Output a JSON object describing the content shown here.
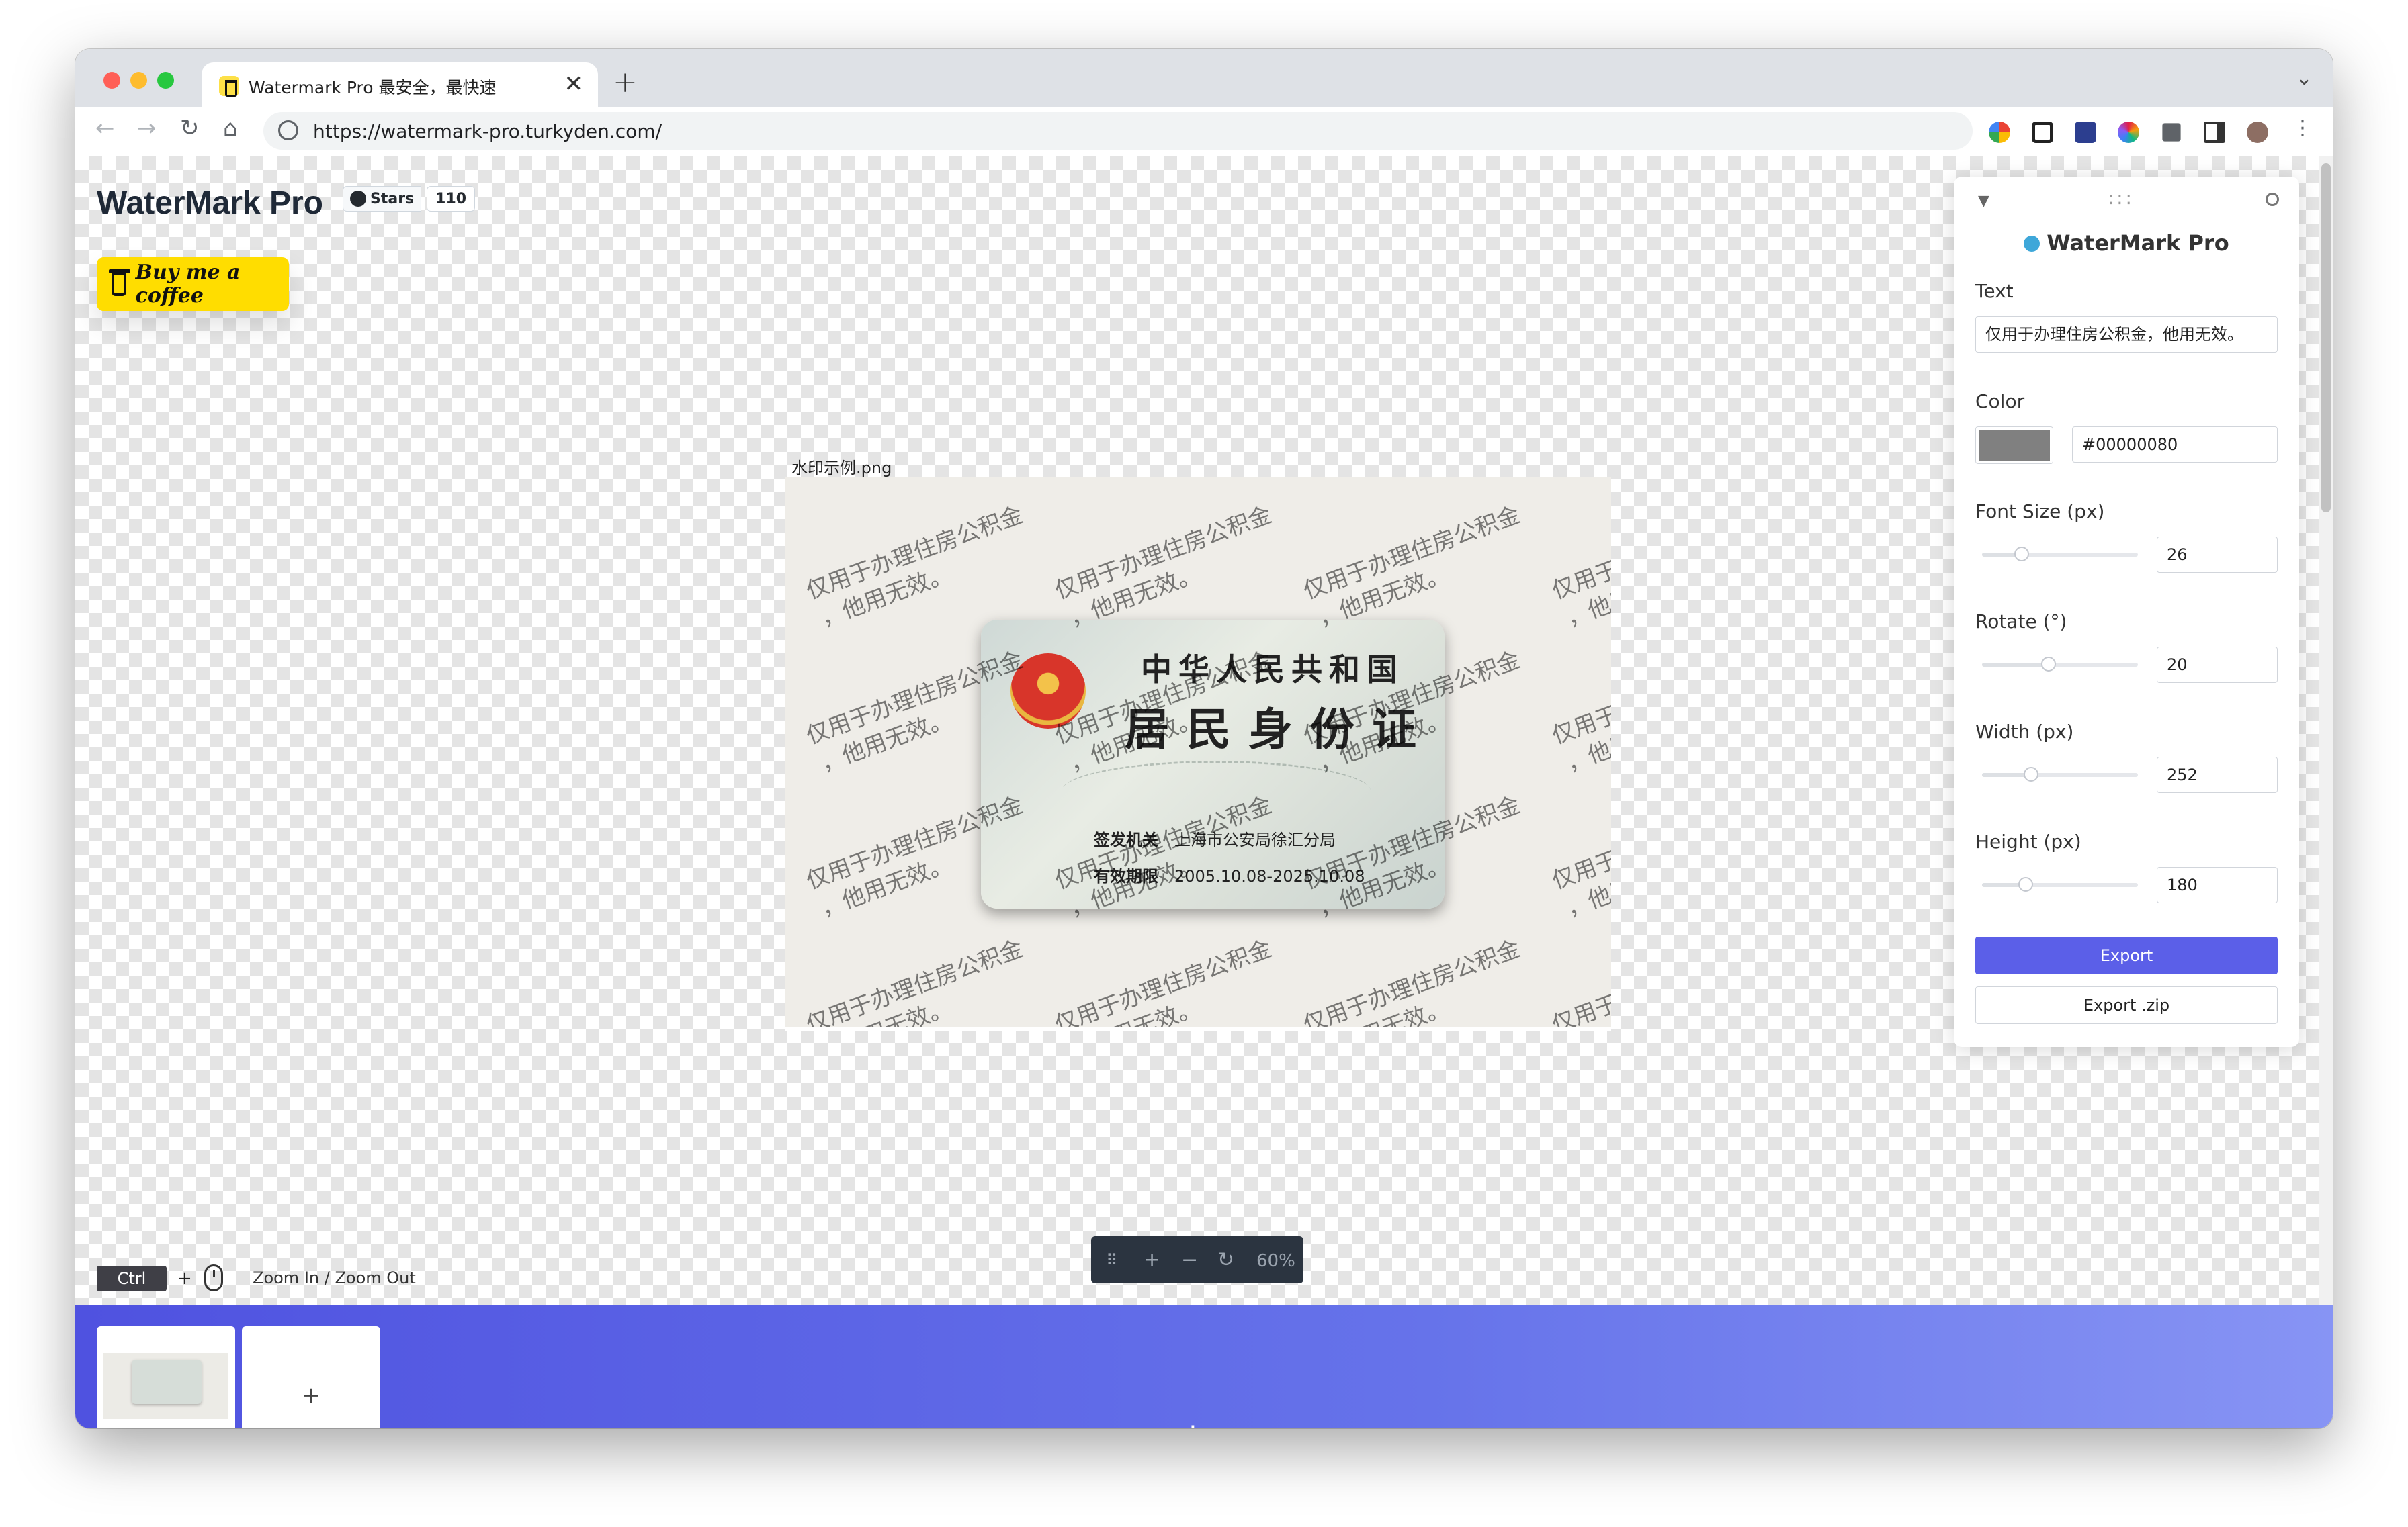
{
  "browser": {
    "tab_title": "Watermark Pro 最安全，最快速",
    "url": "https://watermark-pro.turkyden.com/",
    "new_tab_label": "+",
    "close_tab_label": "✕"
  },
  "header": {
    "brand": "WaterMark Pro",
    "github_label": "Stars",
    "github_count": "110",
    "coffee_label": "Buy me a coffee"
  },
  "preview": {
    "file_name": "水印示例.png",
    "card_title_line1": "中华人民共和国",
    "card_title_line2": "居民身份证",
    "issuer_label": "签发机关",
    "issuer_value": "上海市公安局徐汇分局",
    "valid_label": "有效期限",
    "valid_value": "2005.10.08-2025.10.08",
    "watermark_line1": "仅用于办理住房公积金",
    "watermark_line2": "，他用无效。",
    "watermark_line2_short": "，他用",
    "watermark_line1_short": "仅用于"
  },
  "zoom_hint": {
    "key": "Ctrl",
    "plus": "+",
    "text": "Zoom In / Zoom Out"
  },
  "zoom_bar": {
    "percent": "60%"
  },
  "panel": {
    "title": "WaterMark Pro",
    "text_label": "Text",
    "text_value": "仅用于办理住房公积金，他用无效。",
    "color_label": "Color",
    "color_value": "#00000080",
    "swatch_color": "#808080",
    "font_size_label": "Font Size (px)",
    "font_size_value": "26",
    "rotate_label": "Rotate (°)",
    "rotate_value": "20",
    "width_label": "Width (px)",
    "width_value": "252",
    "height_label": "Height (px)",
    "height_value": "180",
    "export_label": "Export",
    "export_zip_label": "Export .zip"
  },
  "gallery": {
    "add_label": "+"
  },
  "colors": {
    "accent": "#5b5fe8",
    "coffee": "#ffdd00",
    "zoom_bar_bg": "#2b3440"
  }
}
